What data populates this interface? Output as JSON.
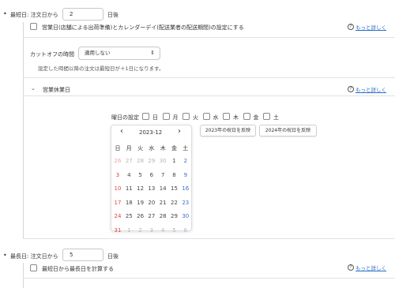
{
  "shortest": {
    "label": "最短日: 注文日から",
    "value": "2",
    "unit": "日後",
    "business_day_label": "営業日(店舗による出荷準備)とカレンダーデイ(配送業者の配送期間)の設定にする",
    "help_link": "もっと詳しく"
  },
  "cutoff": {
    "label": "カットオフの時間",
    "select_value": "適用しない",
    "note": "設定した時間以降の注文は最短日が＋1日になります。",
    "help_link": "もっと詳しく"
  },
  "holidays": {
    "title": "営業休業日",
    "help_link": "もっと詳しく",
    "weekday_label": "曜日の設定",
    "weekdays": [
      "日",
      "月",
      "火",
      "水",
      "木",
      "金",
      "土"
    ],
    "button_2023": "2023年の祝日を反映",
    "button_2024": "2024年の祝日を反映"
  },
  "calendar": {
    "month": "2023-12",
    "prev": "‹",
    "next": "›",
    "weekday_headers": [
      "日",
      "月",
      "火",
      "水",
      "木",
      "金",
      "土"
    ],
    "weeks": [
      [
        "26",
        "27",
        "28",
        "29",
        "30",
        "1",
        "2"
      ],
      [
        "3",
        "4",
        "5",
        "6",
        "7",
        "8",
        "9"
      ],
      [
        "10",
        "11",
        "12",
        "13",
        "14",
        "15",
        "16"
      ],
      [
        "17",
        "18",
        "19",
        "20",
        "21",
        "22",
        "23"
      ],
      [
        "24",
        "25",
        "26",
        "27",
        "28",
        "29",
        "30"
      ],
      [
        "31",
        "1",
        "2",
        "3",
        "4",
        "5",
        "6"
      ]
    ],
    "colors": {
      "sunday": "#e0443e",
      "saturday": "#3b6fd6",
      "link": "#2a6fc9"
    }
  },
  "longest": {
    "label": "最長日: 注文日から",
    "value": "5",
    "unit": "日後",
    "calc_label": "最短日から最長日を計算する",
    "help_link": "もっと詳しく"
  }
}
